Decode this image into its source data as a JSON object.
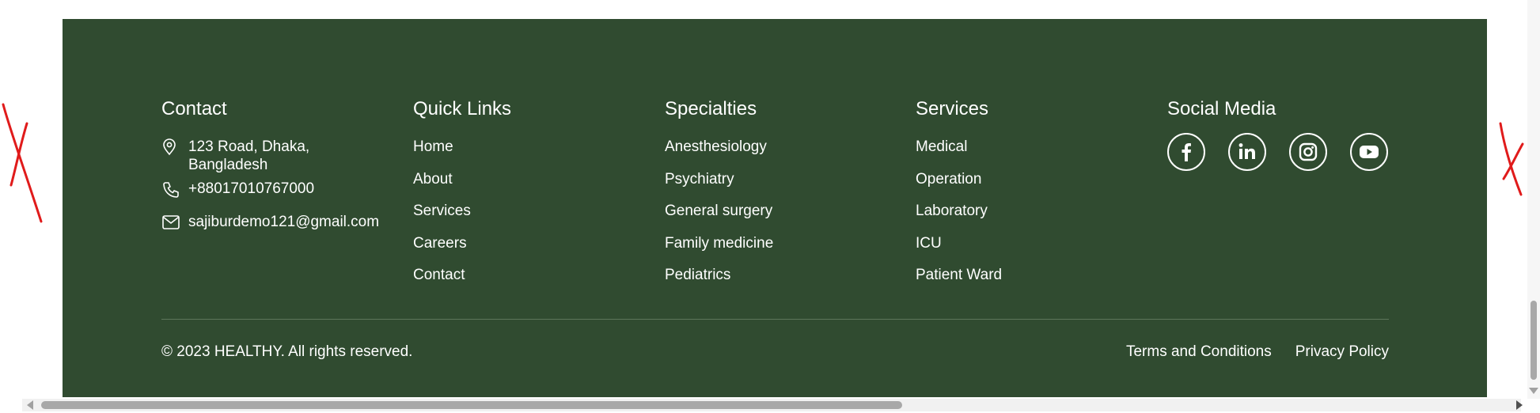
{
  "colors": {
    "footer_bg": "#304b30",
    "text": "#ffffff",
    "divider": "#5d765b",
    "mark": "#e01b1b"
  },
  "contact": {
    "title": "Contact",
    "address": "123 Road, Dhaka, Bangladesh",
    "phone": "+88017010767000",
    "email": "sajiburdemo121@gmail.com",
    "icons": [
      "location-pin-icon",
      "phone-icon",
      "mail-icon"
    ]
  },
  "quick_links": {
    "title": "Quick Links",
    "items": [
      "Home",
      "About",
      "Services",
      "Careers",
      "Contact"
    ]
  },
  "specialties": {
    "title": "Specialties",
    "items": [
      "Anesthesiology",
      "Psychiatry",
      "General surgery",
      "Family medicine",
      "Pediatrics"
    ]
  },
  "services": {
    "title": "Services",
    "items": [
      "Medical",
      "Operation",
      "Laboratory",
      "ICU",
      "Patient Ward"
    ]
  },
  "social": {
    "title": "Social Media",
    "icons": [
      "facebook-icon",
      "linkedin-icon",
      "instagram-icon",
      "youtube-icon"
    ]
  },
  "bottom": {
    "copyright": "© 2023 HEALTHY. All rights reserved.",
    "terms": "Terms and Conditions",
    "privacy": "Privacy Policy"
  }
}
